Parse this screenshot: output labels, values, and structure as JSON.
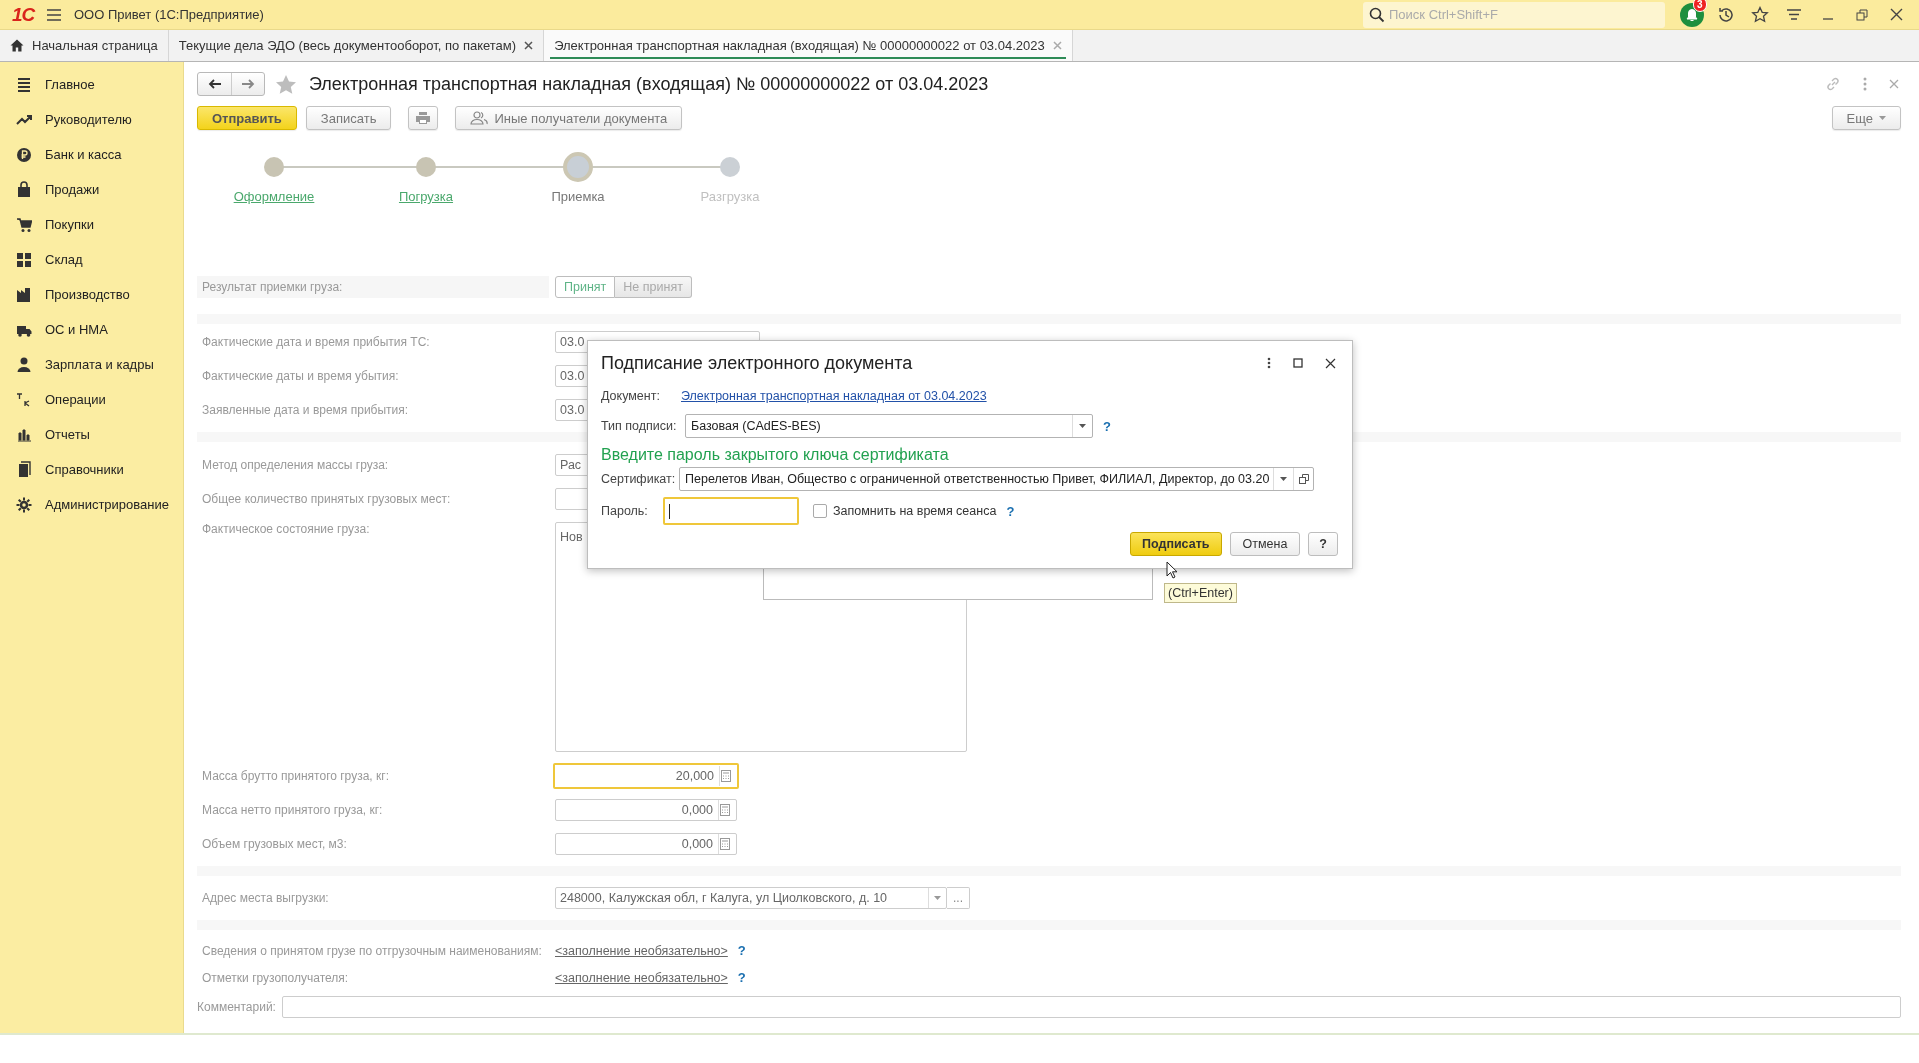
{
  "app_bar": {
    "logo": "1С",
    "title": "ООО Привет  (1С:Предприятие)",
    "search": {
      "placeholder": "Поиск Ctrl+Shift+F"
    },
    "notification_count": "3"
  },
  "tabs": [
    {
      "label": "Начальная страница",
      "selected": false,
      "closable": false
    },
    {
      "label": "Текущие дела ЭДО (весь документооборот, по пакетам)",
      "selected": false,
      "closable": true
    },
    {
      "label": "Электронная транспортная накладная (входящая) № 00000000022 от 03.04.2023",
      "selected": true,
      "closable": true
    }
  ],
  "sidebar": {
    "items": [
      {
        "label": "Главное"
      },
      {
        "label": "Руководителю"
      },
      {
        "label": "Банк и касса"
      },
      {
        "label": "Продажи"
      },
      {
        "label": "Покупки"
      },
      {
        "label": "Склад"
      },
      {
        "label": "Производство"
      },
      {
        "label": "ОС и НМА"
      },
      {
        "label": "Зарплата и кадры"
      },
      {
        "label": "Операции"
      },
      {
        "label": "Отчеты"
      },
      {
        "label": "Справочники"
      },
      {
        "label": "Администрирование"
      }
    ]
  },
  "document": {
    "title": "Электронная транспортная накладная (входящая) № 00000000022 от 03.04.2023",
    "favorite": false,
    "buttons": [
      {
        "kind": "primary",
        "label": "Отправить"
      },
      {
        "kind": "default",
        "label": "Записать"
      },
      {
        "kind": "print"
      },
      {
        "kind": "people",
        "label": "Иные получатели документа"
      }
    ],
    "more_button": "Еще",
    "steps": [
      {
        "label": "Оформление",
        "completed": true,
        "selected": false
      },
      {
        "label": "Погрузка",
        "completed": true,
        "selected": false
      },
      {
        "label": "Приемка",
        "completed": false,
        "selected": true
      },
      {
        "label": "Разгрузка",
        "completed": false,
        "selected": false
      }
    ]
  },
  "form": {
    "result": {
      "label": "Результат приемки груза:",
      "options": [
        {
          "label": "Принят",
          "selected": true
        },
        {
          "label": "Не принят",
          "selected": false
        }
      ]
    },
    "groups": [
      [
        {
          "kind": "date",
          "label": "Фактические дата и время прибытия ТС:",
          "value": "03.0"
        },
        {
          "kind": "date",
          "label": "Фактические даты и время убытия:",
          "value": "03.0"
        },
        {
          "kind": "date",
          "label": "Заявленные дата и время прибытия:",
          "value": "03.0"
        }
      ],
      [
        {
          "kind": "text",
          "label": "Метод определения массы груза:",
          "value": "Рас"
        },
        {
          "kind": "text",
          "label": "Общее количество принятых грузовых мест:"
        },
        {
          "kind": "memo",
          "label": "Фактическое состояние груза:",
          "value": "Нов"
        },
        {
          "kind": "number",
          "label": "Масса брутто принятого груза, кг:",
          "value": "20,000",
          "focused": true
        },
        {
          "kind": "number",
          "label": "Масса нетто принятого груза, кг:",
          "value": "0,000",
          "focused": false
        },
        {
          "kind": "number",
          "label": "Объем грузовых мест, м3:",
          "value": "0,000",
          "focused": false
        }
      ],
      [
        {
          "kind": "address",
          "label": "Адрес места выгрузки:",
          "value": "248000, Калужская обл, г Калуга, ул Циолковского, д. 10",
          "extra_button": "..."
        }
      ],
      [
        {
          "kind": "link",
          "label": "Сведения о принятом грузе по отгрузочным наименованиям:",
          "value": "<заполнение необязательно>",
          "help": "?"
        },
        {
          "kind": "link",
          "label": "Отметки грузополучателя:",
          "value": "<заполнение необязательно>",
          "help": "?"
        }
      ]
    ],
    "comment": {
      "label": "Комментарий:"
    }
  },
  "dialog": {
    "title": "Подписание электронного документа",
    "document": {
      "label": "Документ:",
      "link": "Электронная транспортная накладная от 03.04.2023"
    },
    "signature_type": {
      "label": "Тип подписи:",
      "value": "Базовая (CAdES-BES)",
      "help": "?"
    },
    "prompt": "Введите пароль закрытого ключа сертификата",
    "certificate": {
      "label": "Сертификат:",
      "value": "Перелетов Иван, Общество с ограниченной ответственностью Привет, ФИЛИАЛ, Директор, до 03.20"
    },
    "password": {
      "label": "Пароль:",
      "focused": true
    },
    "remember": {
      "label": "Запомнить на время сеанса",
      "checked": false,
      "help": "?"
    },
    "buttons": [
      {
        "kind": "primary",
        "label": "Подписать"
      },
      {
        "kind": "default",
        "label": "Отмена"
      },
      {
        "kind": "help",
        "label": "?"
      }
    ],
    "tooltip": "(Ctrl+Enter)"
  }
}
